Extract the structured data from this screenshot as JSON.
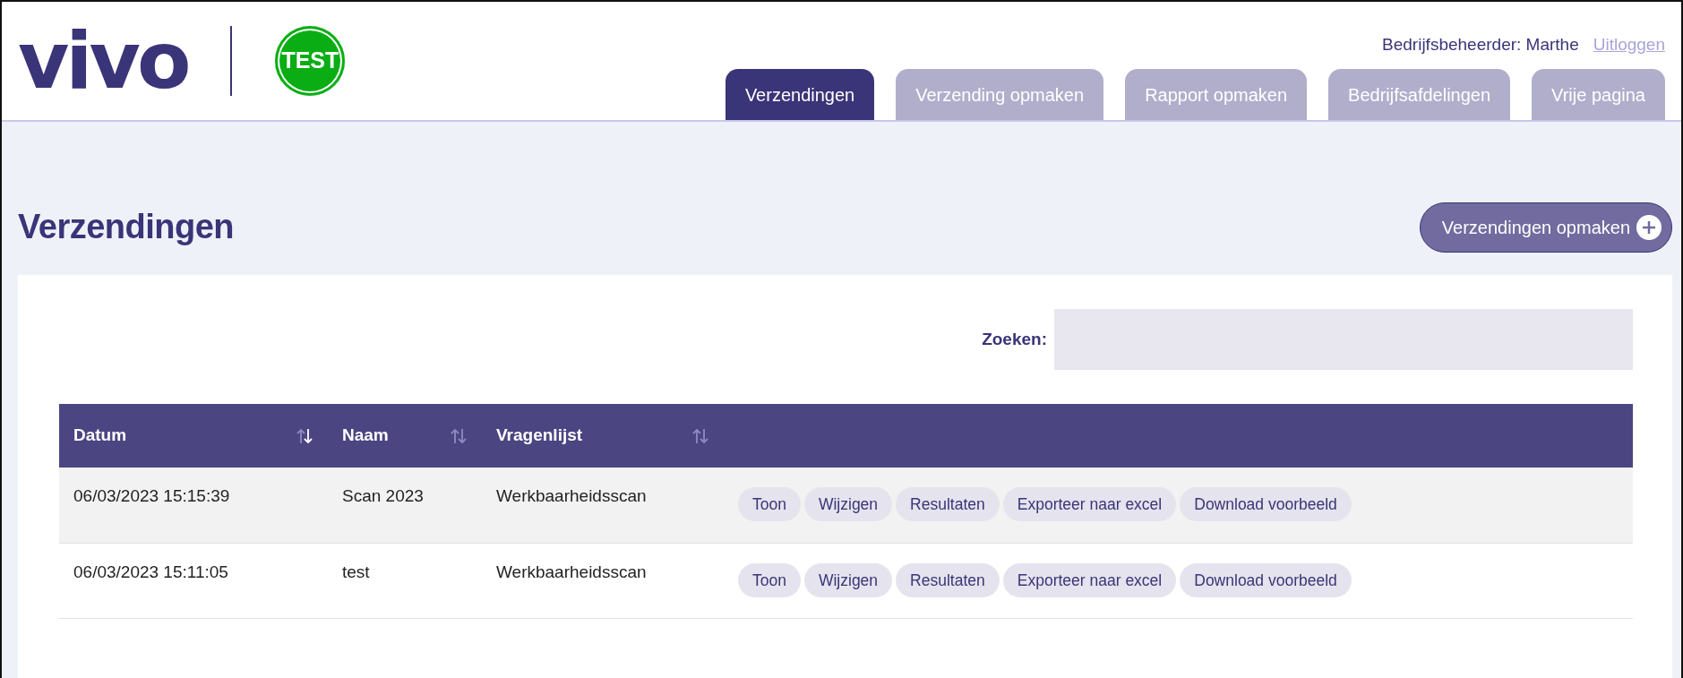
{
  "brand": {
    "logo": "vivo",
    "badge": "TEST"
  },
  "user": {
    "name_label": "Bedrijfsbeheerder: Marthe",
    "logout": "Uitloggen"
  },
  "tabs": [
    {
      "label": "Verzendingen",
      "selected": true
    },
    {
      "label": "Verzending opmaken",
      "selected": false
    },
    {
      "label": "Rapport opmaken",
      "selected": false
    },
    {
      "label": "Bedrijfsafdelingen",
      "selected": false
    },
    {
      "label": "Vrije pagina",
      "selected": false
    }
  ],
  "page": {
    "title": "Verzendingen",
    "action_button": "Verzendingen opmaken"
  },
  "search": {
    "label": "Zoeken:"
  },
  "table": {
    "columns": [
      {
        "label": "Datum",
        "sorted": true
      },
      {
        "label": "Naam",
        "sorted": false
      },
      {
        "label": "Vragenlijst",
        "sorted": false
      }
    ],
    "rows": [
      {
        "cells": [
          "06/03/2023 15:15:39",
          "Scan 2023",
          "Werkbaarheidsscan"
        ],
        "actions": [
          "Toon",
          "Wijzigen",
          "Resultaten",
          "Exporteer naar excel",
          "Download voorbeeld"
        ]
      },
      {
        "cells": [
          "06/03/2023 15:11:05",
          "test",
          "Werkbaarheidsscan"
        ],
        "actions": [
          "Toon",
          "Wijzigen",
          "Resultaten",
          "Exporteer naar excel",
          "Download voorbeeld"
        ]
      }
    ]
  }
}
